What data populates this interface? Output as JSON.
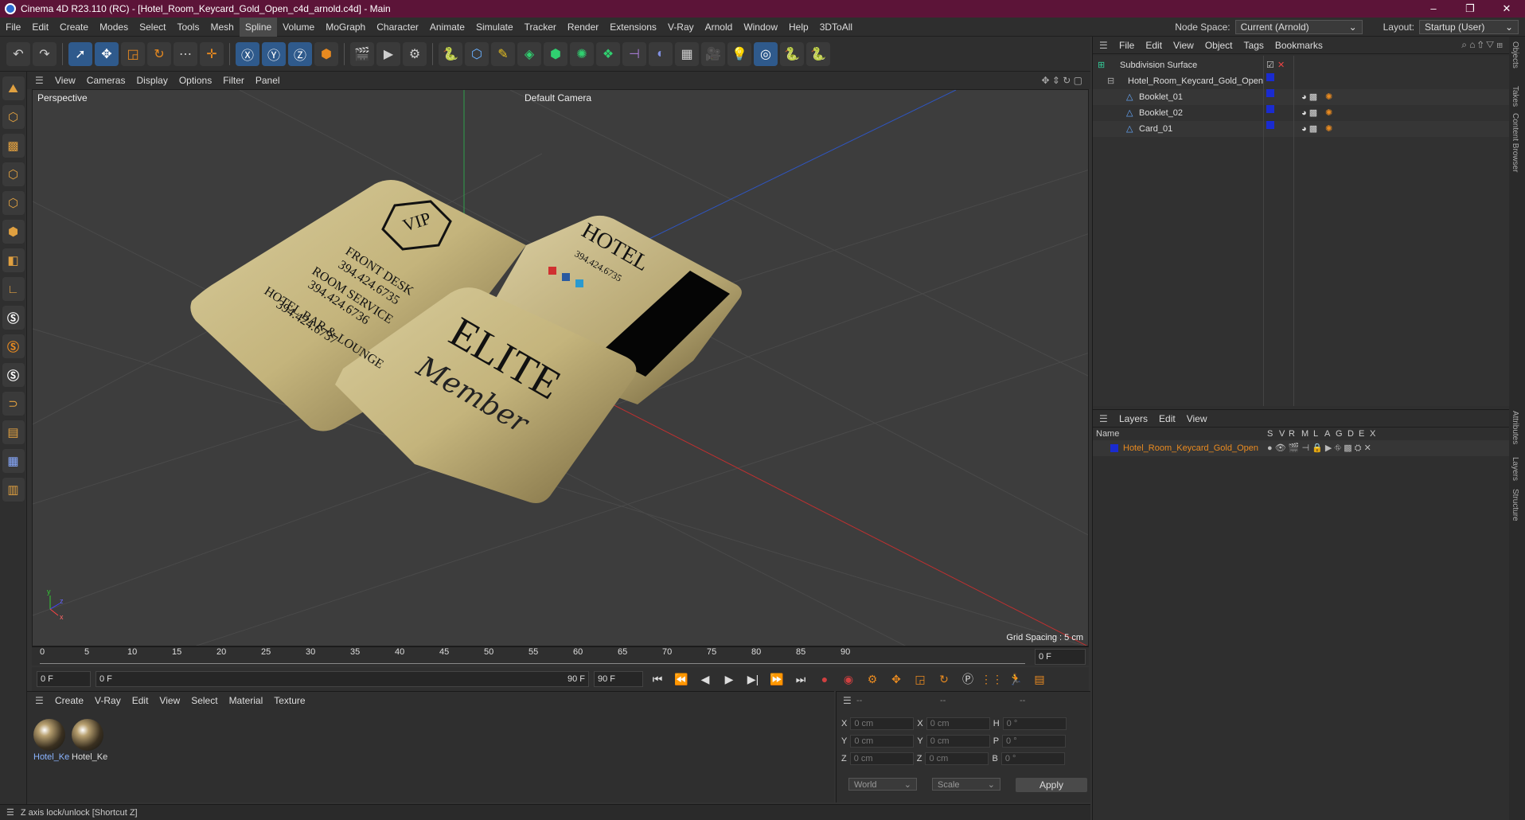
{
  "window": {
    "title": "Cinema 4D R23.110 (RC) - [Hotel_Room_Keycard_Gold_Open_c4d_arnold.c4d] - Main"
  },
  "menubar": {
    "items": [
      "File",
      "Edit",
      "Create",
      "Modes",
      "Select",
      "Tools",
      "Mesh",
      "Spline",
      "Volume",
      "MoGraph",
      "Character",
      "Animate",
      "Simulate",
      "Tracker",
      "Render",
      "Extensions",
      "V-Ray",
      "Arnold",
      "Window",
      "Help",
      "3DToAll"
    ],
    "active": "Spline",
    "node_space_label": "Node Space:",
    "node_space_value": "Current (Arnold)",
    "layout_label": "Layout:",
    "layout_value": "Startup (User)"
  },
  "viewport": {
    "menu": [
      "View",
      "Cameras",
      "Display",
      "Options",
      "Filter",
      "Panel"
    ],
    "label": "Perspective",
    "camera": "Default Camera",
    "grid_spacing": "Grid Spacing : 5 cm",
    "card_text": {
      "booklet": [
        "FRONT DESK",
        "394.424.6735",
        "ROOM SERVICE",
        "394.424.6736",
        "HOTEL BAR & LOUNGE",
        "394.424.6737"
      ],
      "vip": "VIP",
      "hotel": "HOTEL",
      "hotel_phone": "394.424.6735",
      "elite": "ELITE",
      "member": "Member"
    }
  },
  "timeline": {
    "ticks": [
      "0",
      "5",
      "10",
      "15",
      "20",
      "25",
      "30",
      "35",
      "40",
      "45",
      "50",
      "55",
      "60",
      "65",
      "70",
      "75",
      "80",
      "85",
      "90"
    ],
    "current_frame": "0 F"
  },
  "playbar": {
    "start": "0 F",
    "range_start": "0 F",
    "range_end": "90 F",
    "end": "90 F"
  },
  "materials": {
    "menu": [
      "Create",
      "V-Ray",
      "Edit",
      "View",
      "Select",
      "Material",
      "Texture"
    ],
    "items": [
      "Hotel_Ke",
      "Hotel_Ke"
    ]
  },
  "coordinates": {
    "headers": [
      "--",
      "--",
      "--"
    ],
    "rows": [
      {
        "a": "X",
        "av": "0 cm",
        "b": "X",
        "bv": "0 cm",
        "c": "H",
        "cv": "0 °"
      },
      {
        "a": "Y",
        "av": "0 cm",
        "b": "Y",
        "bv": "0 cm",
        "c": "P",
        "cv": "0 °"
      },
      {
        "a": "Z",
        "av": "0 cm",
        "b": "Z",
        "bv": "0 cm",
        "c": "B",
        "cv": "0 °"
      }
    ],
    "mode": "World",
    "scale": "Scale",
    "apply": "Apply"
  },
  "objects": {
    "menu": [
      "File",
      "Edit",
      "View",
      "Object",
      "Tags",
      "Bookmarks"
    ],
    "rows": [
      {
        "name": "Subdivision Surface",
        "indent": 0
      },
      {
        "name": "Hotel_Room_Keycard_Gold_Open",
        "indent": 1
      },
      {
        "name": "Booklet_01",
        "indent": 2
      },
      {
        "name": "Booklet_02",
        "indent": 2
      },
      {
        "name": "Card_01",
        "indent": 2
      }
    ]
  },
  "layers": {
    "menu": [
      "Layers",
      "Edit",
      "View"
    ],
    "col_name": "Name",
    "cols": [
      "S",
      "V",
      "R",
      "M",
      "L",
      "A",
      "G",
      "D",
      "E",
      "X"
    ],
    "rows": [
      {
        "name": "Hotel_Room_Keycard_Gold_Open"
      }
    ]
  },
  "sidetabs": [
    "Objects",
    "Takes",
    "Content Browser",
    "Attributes",
    "Layers",
    "Structure"
  ],
  "status": "Z axis lock/unlock [Shortcut Z]"
}
